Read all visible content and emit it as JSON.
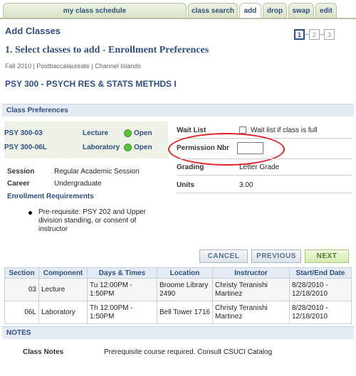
{
  "tabs": [
    {
      "label": "my class schedule",
      "active": false
    },
    {
      "label": "class search",
      "active": false
    },
    {
      "label": "add",
      "active": true
    },
    {
      "label": "drop",
      "active": false
    },
    {
      "label": "swap",
      "active": false
    },
    {
      "label": "edit",
      "active": false
    }
  ],
  "page": {
    "title": "Add Classes",
    "steps": [
      "1",
      "2",
      "3"
    ],
    "subtitle": "1.  Select classes to add - Enrollment Preferences",
    "term_line": "Fall 2010 | Postbaccalaureate | Channel Islands",
    "course_title": "PSY  300 - PSYCH RES & STATS METHDS I"
  },
  "prefs": {
    "section_title": "Class Preferences",
    "classes": [
      {
        "id": "PSY  300-03",
        "component": "Lecture",
        "status": "Open"
      },
      {
        "id": "PSY  300-06L",
        "component": "Laboratory",
        "status": "Open"
      }
    ],
    "session_label": "Session",
    "session_value": "Regular Academic Session",
    "career_label": "Career",
    "career_value": "Undergraduate",
    "enroll_req_label": "Enrollment Requirements",
    "prereq_text": "Pre-requisite: PSY 202 and Upper division standing, or consent of instructor",
    "waitlist_label": "Wait List",
    "waitlist_checkbox_label": "Wait list if class is full",
    "permission_label": "Permission Nbr",
    "permission_value": "",
    "grading_label": "Grading",
    "grading_value": "Letter Grade",
    "units_label": "Units",
    "units_value": "3.00"
  },
  "buttons": {
    "cancel": "Cancel",
    "previous": "Previous",
    "next": "Next"
  },
  "table": {
    "headers": [
      "Section",
      "Component",
      "Days & Times",
      "Location",
      "Instructor",
      "Start/End Date"
    ],
    "rows": [
      {
        "section": "03",
        "component": "Lecture",
        "days_times": "Tu 12:00PM - 1:50PM",
        "location": "Broome Library 2490",
        "instructor": "Christy Teranishi Martinez",
        "dates": "8/28/2010 - 12/18/2010"
      },
      {
        "section": "06L",
        "component": "Laboratory",
        "days_times": "Th 12:00PM - 1:50PM",
        "location": "Bell Tower 1716",
        "instructor": "Christy Teranishi Martinez",
        "dates": "8/28/2010 - 12/18/2010"
      }
    ]
  },
  "notes": {
    "section_title": "NOTES",
    "label": "Class Notes",
    "text": "Prerequisite course required. Consult CSUCI Catalog"
  },
  "colors": {
    "accent": "#2f4f7f",
    "open_status": "#5fbf3d",
    "highlight_ellipse": "#e3202a"
  }
}
